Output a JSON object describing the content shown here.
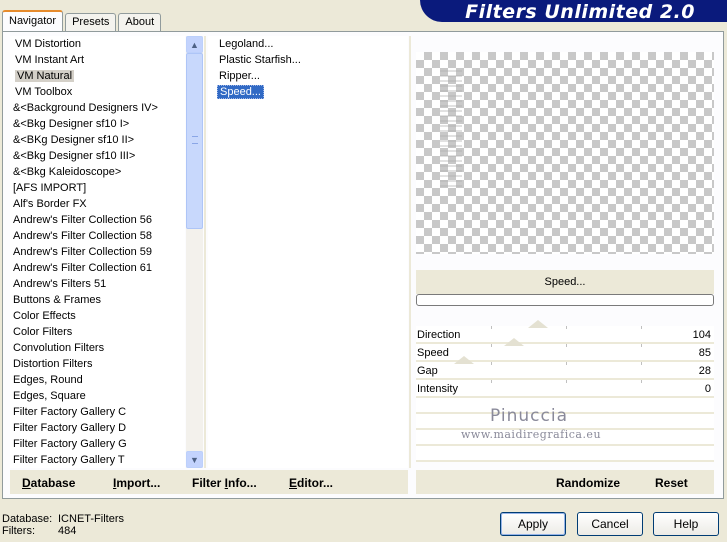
{
  "tabs": [
    "Navigator",
    "Presets",
    "About"
  ],
  "banner_title": "Filters Unlimited 2.0",
  "categories": [
    "VM Distortion",
    "VM Instant Art",
    "VM Natural",
    "VM Toolbox",
    "&<Background Designers IV>",
    "&<Bkg Designer sf10 I>",
    "&<BKg Designer sf10 II>",
    "&<Bkg Designer sf10 III>",
    "&<Bkg Kaleidoscope>",
    "[AFS IMPORT]",
    "Alf's Border FX",
    "Andrew's Filter Collection 56",
    "Andrew's Filter Collection 58",
    "Andrew's Filter Collection 59",
    "Andrew's Filter Collection 61",
    "Andrew's Filters 51",
    "Buttons & Frames",
    "Color Effects",
    "Color Filters",
    "Convolution Filters",
    "Distortion Filters",
    "Edges, Round",
    "Edges, Square",
    "Filter Factory Gallery C",
    "Filter Factory Gallery D",
    "Filter Factory Gallery G",
    "Filter Factory Gallery T"
  ],
  "selected_category": "VM Natural",
  "filters": [
    "Legoland...",
    "Plastic Starfish...",
    "Ripper...",
    "Speed..."
  ],
  "selected_filter": "Speed...",
  "preview_filter_name": "Speed...",
  "progress": 0,
  "params": [
    {
      "label": "Direction",
      "value": "104"
    },
    {
      "label": "Speed",
      "value": "85"
    },
    {
      "label": "Gap",
      "value": "28"
    },
    {
      "label": "Intensity",
      "value": "0"
    }
  ],
  "watermark": {
    "line1": "Pinuccia",
    "line2": "www.maidiregrafica.eu"
  },
  "left_buttons": {
    "database": "Database",
    "import": "Import...",
    "filter_info": "Filter Info...",
    "editor": "Editor..."
  },
  "right_buttons": {
    "randomize": "Randomize",
    "reset": "Reset"
  },
  "footer": {
    "database_label": "Database:",
    "database_value": "ICNET-Filters",
    "filters_label": "Filters:",
    "filters_value": "484"
  },
  "dialog_buttons": {
    "apply": "Apply",
    "cancel": "Cancel",
    "help": "Help"
  },
  "colors": {
    "banner": "#0a1a7c",
    "selection": "#316ac5",
    "dialog_bg": "#ece9d8"
  }
}
